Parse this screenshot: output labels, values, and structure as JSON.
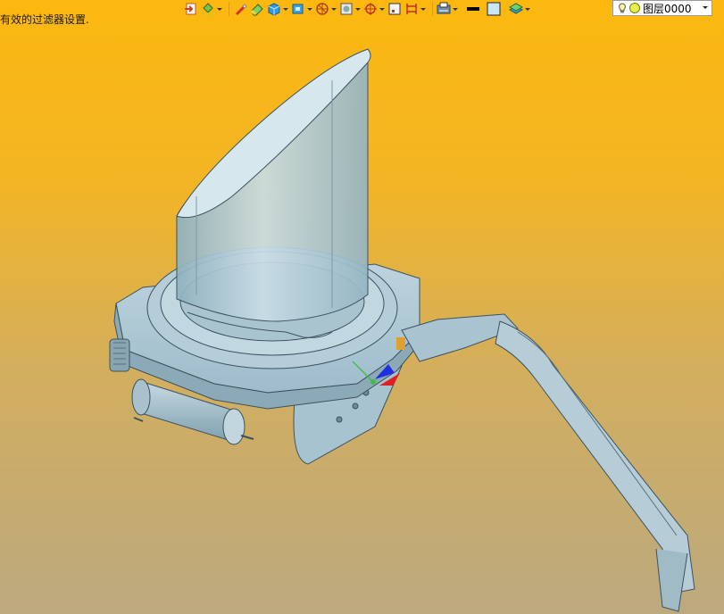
{
  "status": {
    "message": "有效的过滤器设置."
  },
  "toolbar": {
    "buttons": [
      {
        "name": "import-icon",
        "dropdown": false
      },
      {
        "name": "paint-bucket-icon",
        "dropdown": true
      },
      {
        "name": "brush-icon",
        "dropdown": false
      },
      {
        "name": "eraser-icon",
        "dropdown": false
      },
      {
        "name": "solid-box-icon",
        "dropdown": true
      },
      {
        "name": "view-cube-icon",
        "dropdown": true
      },
      {
        "name": "orientation-wheel-icon",
        "dropdown": true
      },
      {
        "name": "render-mode-icon",
        "dropdown": true
      },
      {
        "name": "snap-target-icon",
        "dropdown": true
      },
      {
        "name": "frame-icon",
        "dropdown": false
      },
      {
        "name": "dimension-icon",
        "dropdown": true
      },
      {
        "name": "print-preview-icon",
        "dropdown": true
      },
      {
        "name": "line-color-icon",
        "dropdown": false
      },
      {
        "name": "fill-color-icon",
        "dropdown": false
      },
      {
        "name": "layer-stack-icon",
        "dropdown": true
      }
    ],
    "layer_select": {
      "value": "图层0000"
    }
  },
  "colors": {
    "background_top": "#fcb80f",
    "background_bottom": "#bca97f",
    "model_fill": "#a9c6d3",
    "model_edge": "#3c5260"
  }
}
